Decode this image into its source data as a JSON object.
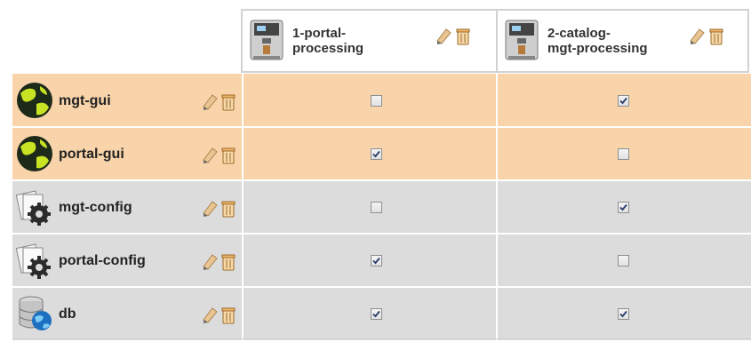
{
  "columns": [
    {
      "label": "1-portal-\nprocessing",
      "line1": "1-portal-",
      "line2": "processing"
    },
    {
      "label": "2-catalog-\nmgt-processing",
      "line1": "2-catalog-",
      "line2": "mgt-processing"
    }
  ],
  "rows": [
    {
      "label": "mgt-gui",
      "icon": "globe-icon",
      "color": "#f9d4aa",
      "checked": [
        false,
        true
      ]
    },
    {
      "label": "portal-gui",
      "icon": "globe-icon",
      "color": "#f9d4aa",
      "checked": [
        true,
        false
      ]
    },
    {
      "label": "mgt-config",
      "icon": "config-gear-icon",
      "color": "#dcdcdc",
      "checked": [
        false,
        true
      ]
    },
    {
      "label": "portal-config",
      "icon": "config-gear-icon",
      "color": "#dcdcdc",
      "checked": [
        true,
        false
      ]
    },
    {
      "label": "db",
      "icon": "database-icon",
      "color": "#dcdcdc",
      "checked": [
        true,
        true
      ]
    }
  ]
}
